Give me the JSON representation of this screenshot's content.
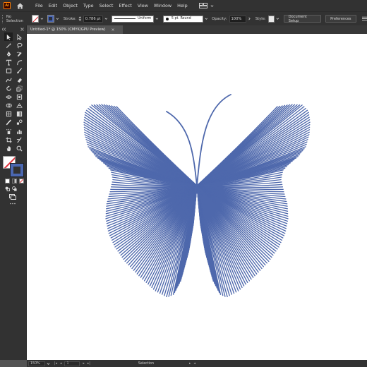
{
  "app": {
    "logo_text": "Ai",
    "menu": [
      "File",
      "Edit",
      "Object",
      "Type",
      "Select",
      "Effect",
      "View",
      "Window",
      "Help"
    ]
  },
  "control_bar": {
    "selection_label": "No Selection",
    "stroke_label": "Stroke:",
    "stroke_weight": "0.786 pt",
    "profile_label": "Uniform",
    "brush_label": "5 pt. Round",
    "opacity_label": "Opacity:",
    "opacity_value": "100%",
    "style_label": "Style:",
    "document_setup_label": "Document Setup",
    "preferences_label": "Preferences",
    "fill_color": "#ffffff",
    "stroke_color": "#4b67b0"
  },
  "document": {
    "tab_title": "Untitled-1* @ 150% (CMYK/GPU Preview)",
    "artwork_color": "#4e68ac"
  },
  "status_bar": {
    "zoom": "150%",
    "artboard": "1",
    "tool_name": "Selection"
  }
}
